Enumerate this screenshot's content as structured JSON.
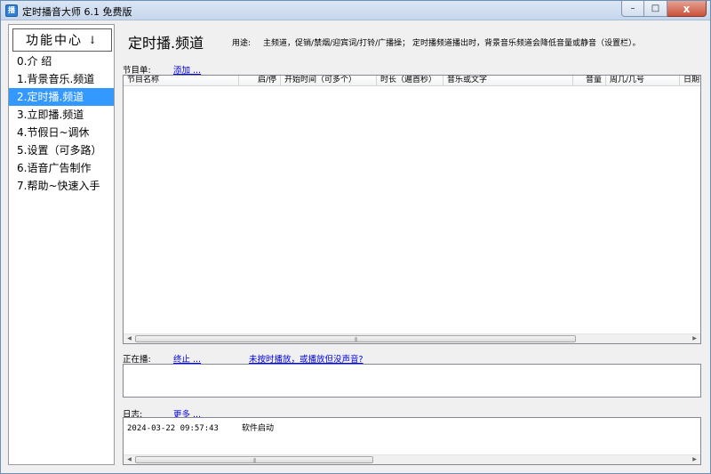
{
  "window": {
    "icon_glyph": "播",
    "title": "定时播音大师 6.1 免费版",
    "min_glyph": "–",
    "max_glyph": "□",
    "close_glyph": "x"
  },
  "sidebar": {
    "header": "功能中心",
    "header_arrow": "↓",
    "items": [
      {
        "label": "0.介 绍"
      },
      {
        "label": "1.背景音乐.频道"
      },
      {
        "label": "2.定时播.频道"
      },
      {
        "label": "3.立即播.频道"
      },
      {
        "label": "4.节假日~调休"
      },
      {
        "label": "5.设置（可多路）"
      },
      {
        "label": "6.语音广告制作"
      },
      {
        "label": "7.帮助~快速入手"
      }
    ],
    "active_index": 2
  },
  "main": {
    "title": "定时播.频道",
    "usage_label": "用途:",
    "usage_text": "主频道，促销/禁烟/迎宾词/打铃/广播操；  定时播频道播出时，背景音乐频道会降低音量或静音（设置栏）。"
  },
  "program_list": {
    "label": "节目单:",
    "add_link": "添加 ...",
    "columns": [
      "节目名称",
      "启/停",
      "开始时间（可多个）",
      "时长（遍首秒）",
      "音乐或文字",
      "音量",
      "周几/几号",
      "日期范"
    ]
  },
  "now_playing": {
    "label": "正在播:",
    "stop_link": "终止 ...",
    "help_link": "未按时播放，或播放但没声音?"
  },
  "log": {
    "label": "日志:",
    "more_link": "更多 ...",
    "entries": [
      {
        "time": "2024-03-22 09:57:43",
        "message": "软件启动"
      }
    ]
  },
  "scrollbar": {
    "left_glyph": "◀",
    "right_glyph": "▶",
    "grip": "|||"
  },
  "colors": {
    "selection": "#3399ff",
    "link": "#0000ee"
  }
}
